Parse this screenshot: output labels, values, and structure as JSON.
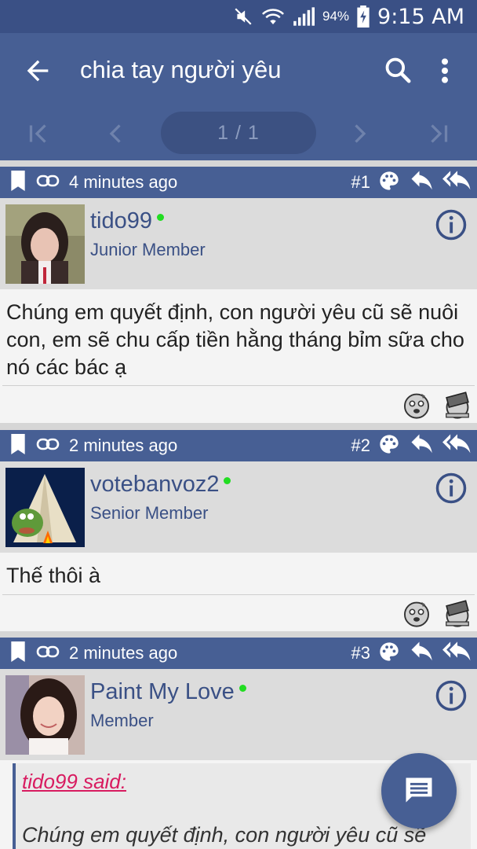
{
  "status_bar": {
    "battery": "94%",
    "time": "9:15 AM"
  },
  "app_bar": {
    "title": "chia tay người yêu"
  },
  "pager": {
    "label": "1 / 1"
  },
  "posts": [
    {
      "time": "4 minutes ago",
      "number": "#1",
      "username": "tido99",
      "role": "Junior Member",
      "content": "Chúng em quyết định, con người yêu cũ sẽ nuôi con, em sẽ chu cấp tiền hằng tháng bỉm sữa cho nó các bác ạ"
    },
    {
      "time": "2 minutes ago",
      "number": "#2",
      "username": "votebanvoz2",
      "role": "Senior Member",
      "content": "Thế thôi à"
    },
    {
      "time": "2 minutes ago",
      "number": "#3",
      "username": "Paint My Love",
      "role": "Member",
      "quote_author": "tido99 said:",
      "quote_text": "Chúng em quyết định, con người yêu cũ sẽ"
    }
  ],
  "colors": {
    "primary": "#475f94",
    "status": "#3a5085",
    "online": "#22dd22",
    "quote_author": "#d81b60"
  }
}
